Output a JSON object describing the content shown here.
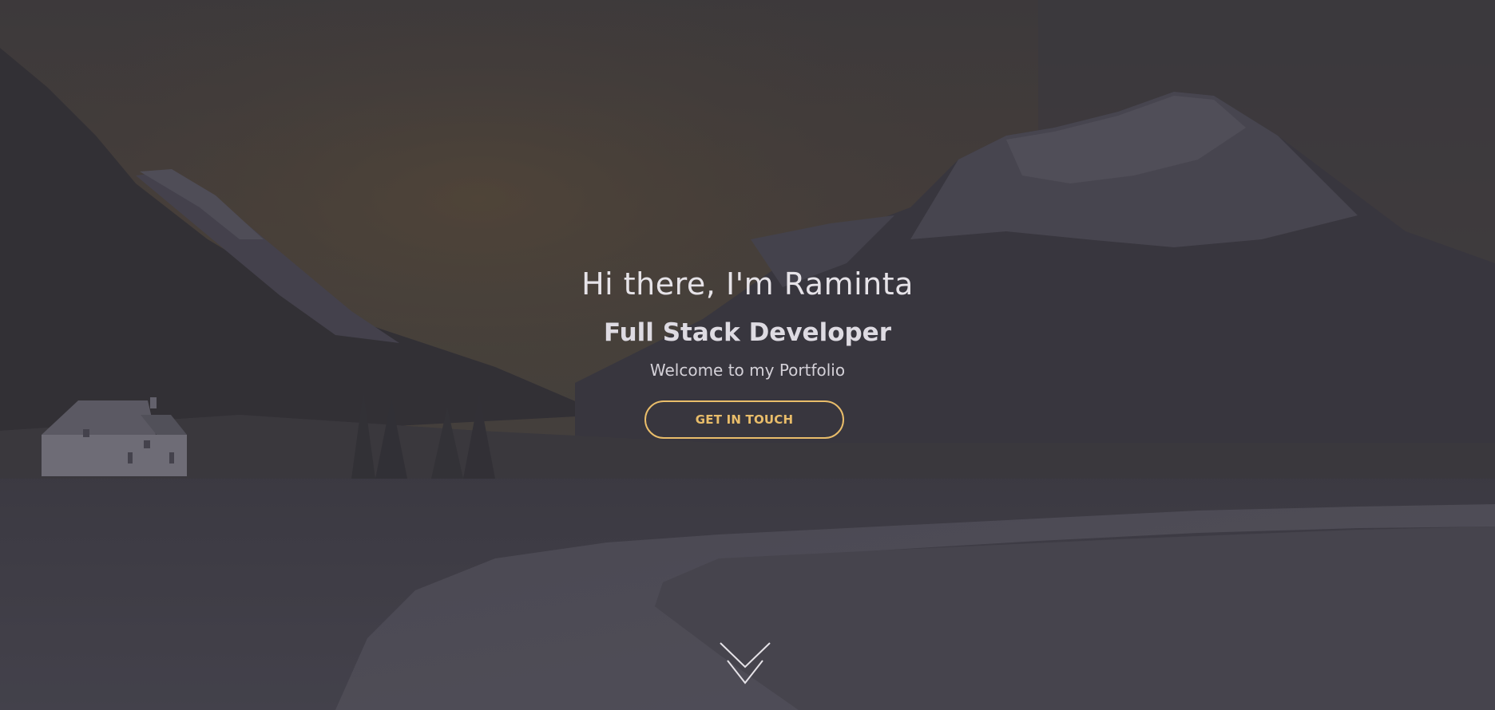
{
  "hero": {
    "heading": "Hi there, I'm Raminta",
    "role": "Full Stack Developer",
    "welcome": "Welcome to my Portfolio",
    "cta_label": "GET IN TOUCH",
    "scroll_icon": "chevron-double-down-icon",
    "background_image": "mountain-valley-cottage-river-landscape"
  },
  "colors": {
    "accent": "#e9bd6a",
    "text_primary": "#e6e3e8",
    "overlay": "#3a3844"
  }
}
